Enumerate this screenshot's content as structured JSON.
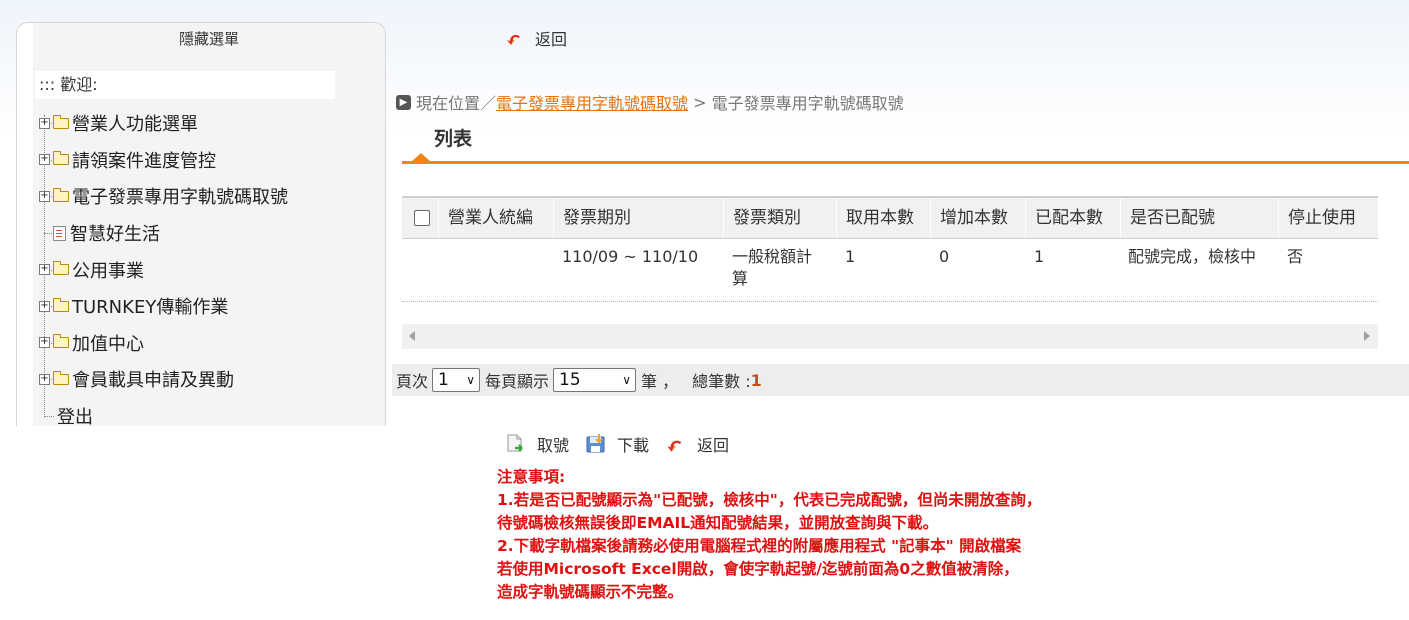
{
  "sidebar": {
    "title": "隱藏選單",
    "welcome": "::: 歡迎:",
    "items": [
      {
        "label": "營業人功能選單"
      },
      {
        "label": "請領案件進度管控"
      },
      {
        "label": "電子發票專用字軌號碼取號"
      },
      {
        "label": "智慧好生活"
      },
      {
        "label": "公用事業"
      },
      {
        "label": "TURNKEY傳輸作業"
      },
      {
        "label": "加值中心"
      },
      {
        "label": "會員載具申請及異動"
      },
      {
        "label": "登出"
      }
    ]
  },
  "top_return_label": "返回",
  "breadcrumb": {
    "prefix": "現在位置／",
    "link": "電子發票專用字軌號碼取號",
    "separator": " > ",
    "current": "電子發票專用字軌號碼取號"
  },
  "tab_label": "列表",
  "table": {
    "headers": [
      "營業人統編",
      "發票期別",
      "發票類別",
      "取用本數",
      "增加本數",
      "已配本數",
      "是否已配號",
      "停止使用"
    ],
    "rows": [
      {
        "tax_id": "",
        "period": "110/09 ~ 110/10",
        "type": "一般稅額計算",
        "taken": "1",
        "added": "0",
        "assigned": "1",
        "status": "配號完成，檢核中",
        "stopped": "否"
      }
    ]
  },
  "pager": {
    "page_label": "頁次",
    "page_value": "1",
    "per_page_label": "每頁顯示",
    "per_page_value": "15",
    "unit_label": "筆 ，",
    "total_label": "總筆數 :",
    "total_value": "1"
  },
  "actions": {
    "take_label": "取號",
    "download_label": "下載",
    "return_label": "返回"
  },
  "notice": {
    "title": "注意事項:",
    "line1": "1.若是否已配號顯示為\"已配號，檢核中\"，代表已完成配號，但尚未開放查詢，",
    "line2": "待號碼檢核無誤後即EMAIL通知配號結果，並開放查詢與下載。",
    "line3": "2.下載字軌檔案後請務必使用電腦程式裡的附屬應用程式 \"記事本\" 開啟檔案",
    "line4": "若使用Microsoft Excel開啟，會使字軌起號/迄號前面為0之數值被清除，",
    "line5": "造成字軌號碼顯示不完整。"
  },
  "colors": {
    "accent_orange": "#ef8512",
    "notice_red": "#e01010",
    "link_orange": "#e2740f"
  }
}
